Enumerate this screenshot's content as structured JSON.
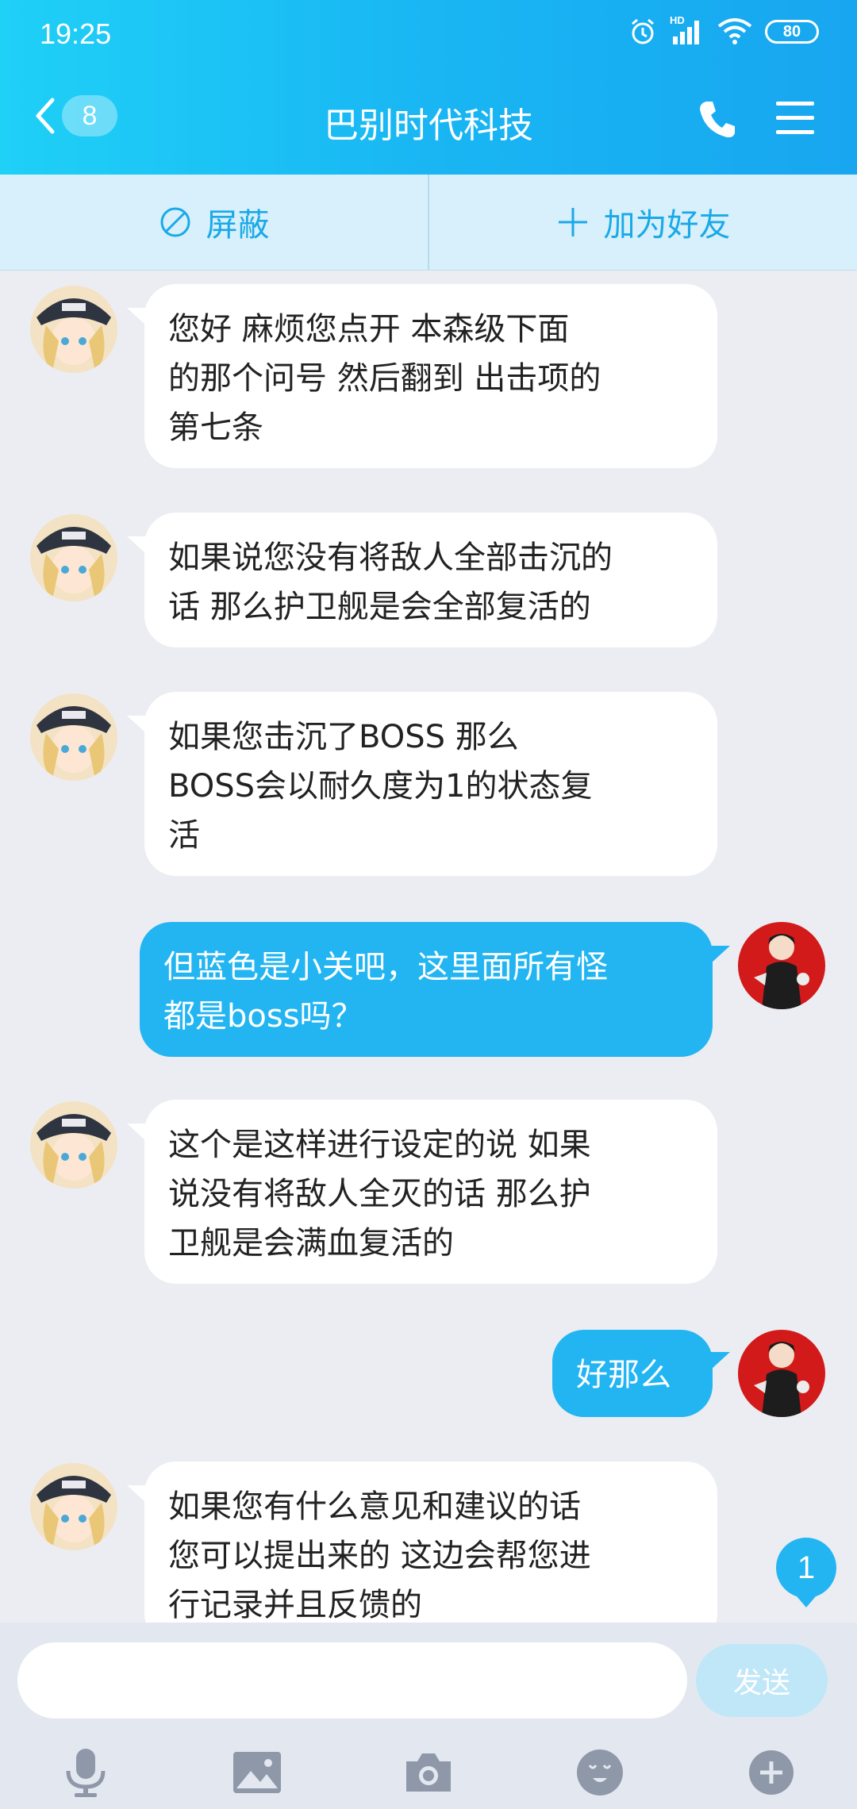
{
  "status_bar": {
    "time": "19:25",
    "battery": "80",
    "network": "HD"
  },
  "header": {
    "back_count": "8",
    "title": "巴别时代科技"
  },
  "actions": {
    "block_label": "屏蔽",
    "add_friend_label": "加为好友"
  },
  "messages": [
    {
      "from": "them",
      "text": "您好  麻烦您点开  本森级下面\n的那个问号  然后翻到 出击项的\n第七条"
    },
    {
      "from": "them",
      "text": "如果说您没有将敌人全部击沉的\n话  那么护卫舰是会全部复活的"
    },
    {
      "from": "them",
      "text": "如果您击沉了BOSS  那么\nBOSS会以耐久度为1的状态复\n活"
    },
    {
      "from": "me",
      "text": "但蓝色是小关吧，这里面所有怪\n都是boss吗？"
    },
    {
      "from": "them",
      "text": "这个是这样进行设定的说  如果\n说没有将敌人全灭的话  那么护\n卫舰是会满血复活的"
    },
    {
      "from": "me",
      "text": "好那么"
    },
    {
      "from": "them",
      "text": "如果您有什么意见和建议的话\n您可以提出来的  这边会帮您进\n行记录并且反馈的"
    }
  ],
  "unread_badge": "1",
  "composer": {
    "placeholder": "",
    "send_label": "发送"
  },
  "toolbar": [
    "microphone-icon",
    "image-icon",
    "camera-icon",
    "emoji-icon",
    "plus-icon"
  ],
  "colors": {
    "header": "#19b6f3",
    "bubble_out": "#22b5f2",
    "action_bar": "#d7f0fb"
  }
}
